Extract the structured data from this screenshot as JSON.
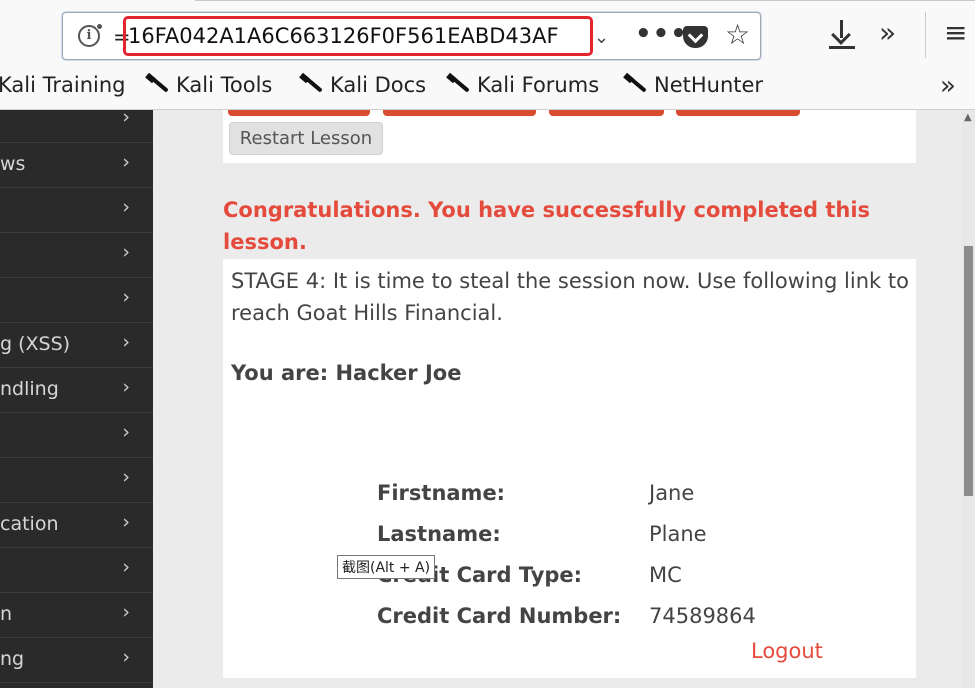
{
  "browser": {
    "url_prefix": "=",
    "url_text": "16FA042A1A6C663126F0F561EABD43AF",
    "more_label": "•••",
    "star_icon": "star-icon",
    "overflow_label": "»",
    "menu_label": "≡"
  },
  "bookmarks": {
    "items": [
      {
        "label": "Kali Training",
        "icon": false
      },
      {
        "label": "Kali Tools",
        "icon": true
      },
      {
        "label": "Kali Docs",
        "icon": true
      },
      {
        "label": "Kali Forums",
        "icon": true
      },
      {
        "label": "NetHunter",
        "icon": true
      }
    ],
    "more_label": "»"
  },
  "sidebar": {
    "items": [
      {
        "label": ""
      },
      {
        "label": "ws"
      },
      {
        "label": ""
      },
      {
        "label": ""
      },
      {
        "label": ""
      },
      {
        "label": "g (XSS)"
      },
      {
        "label": "ndling"
      },
      {
        "label": ""
      },
      {
        "label": ""
      },
      {
        "label": "cation"
      },
      {
        "label": ""
      },
      {
        "label": "n"
      },
      {
        "label": "ng"
      }
    ],
    "chevron": "›"
  },
  "lesson": {
    "restart_label": "Restart Lesson",
    "congrats": "Congratulations. You have successfully completed this lesson.",
    "stage_text": "STAGE 4: It is time to steal the session now. Use following link to reach Goat Hills Financial.",
    "you_are": "You are: Hacker Joe",
    "fields": [
      {
        "key": "Firstname:",
        "value": "Jane"
      },
      {
        "key": "Lastname:",
        "value": "Plane"
      },
      {
        "key": "Credit Card Type:",
        "value": "MC"
      },
      {
        "key": "Credit Card Number:",
        "value": "74589864"
      }
    ],
    "logout_label": "Logout"
  },
  "tooltip": {
    "text": "截图(Alt + A)"
  },
  "colors": {
    "accent_red": "#e54b3c",
    "url_highlight": "#e3262d",
    "sidebar_bg": "#2a2a2a"
  }
}
